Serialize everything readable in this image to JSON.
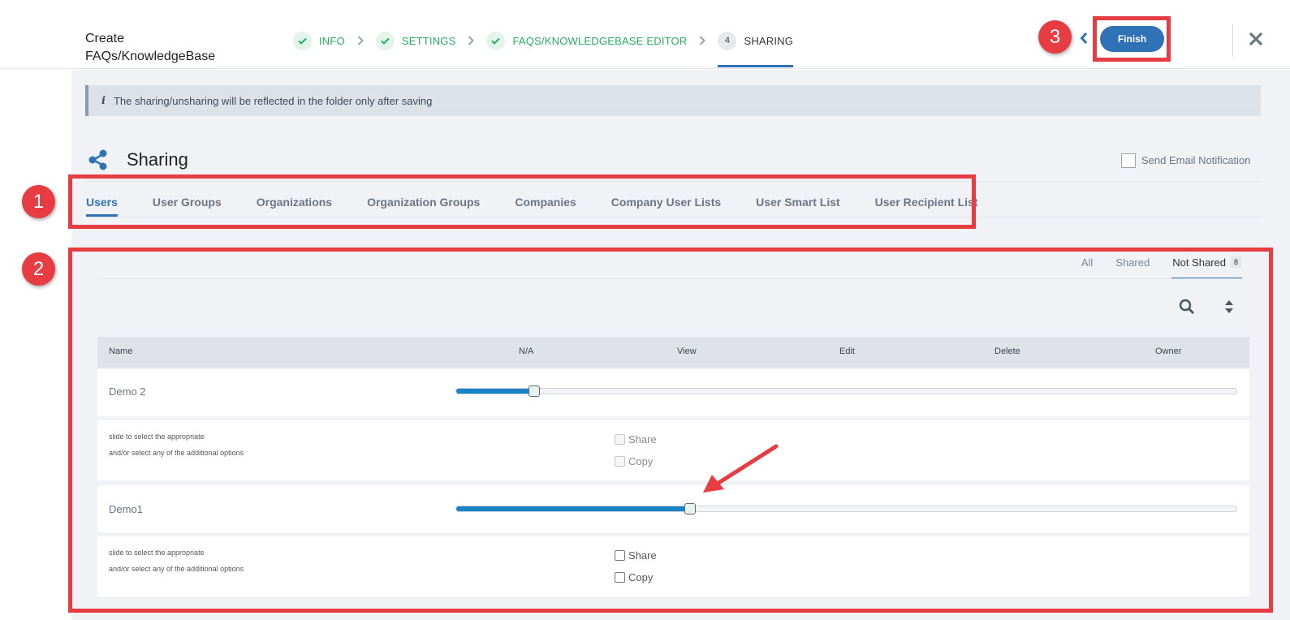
{
  "header": {
    "title": "Create FAQs/KnowledgeBase",
    "steps": [
      {
        "label": "INFO",
        "state": "done"
      },
      {
        "label": "SETTINGS",
        "state": "done"
      },
      {
        "label": "FAQS/KNOWLEDGEBASE EDITOR",
        "state": "done"
      },
      {
        "label": "SHARING",
        "number": "4",
        "state": "active"
      }
    ],
    "finish_label": "Finish",
    "icons": {
      "back": "chevron-left-icon",
      "close": "close-icon",
      "step_done": "check-icon"
    }
  },
  "banner": {
    "text": "The sharing/unsharing will be reflected in the folder only after saving",
    "icon": "i"
  },
  "section": {
    "title": "Sharing",
    "icon": "share-icon",
    "email_notification_label": "Send Email Notification",
    "email_notification_checked": false
  },
  "tabs": [
    "Users",
    "User Groups",
    "Organizations",
    "Organization Groups",
    "Companies",
    "Company User Lists",
    "User Smart List",
    "User Recipient List"
  ],
  "active_tab": "Users",
  "filters": {
    "all": "All",
    "shared": "Shared",
    "not_shared": "Not Shared",
    "not_shared_count": "8",
    "active": "Not Shared"
  },
  "table": {
    "columns": [
      "Name",
      "N/A",
      "View",
      "Edit",
      "Delete",
      "Owner"
    ],
    "rows": [
      {
        "name": "Demo 2",
        "permission_fraction": 0.1,
        "hint_line1": "slide to select the appropriate",
        "hint_line2": "and/or select any of the additional options",
        "share_label": "Share",
        "copy_label": "Copy",
        "options_enabled": false
      },
      {
        "name": "Demo1",
        "permission_fraction": 0.3,
        "hint_line1": "slide to select the appropriate",
        "hint_line2": "and/or select any of the additional options",
        "share_label": "Share",
        "copy_label": "Copy",
        "options_enabled": true
      }
    ]
  },
  "annotations": {
    "num1": "1",
    "num2": "2",
    "num3": "3",
    "color": "#e73c42"
  },
  "colors": {
    "accent": "#2f72b5",
    "done_green": "#27ae60",
    "slider_fill": "#1a82c8"
  }
}
